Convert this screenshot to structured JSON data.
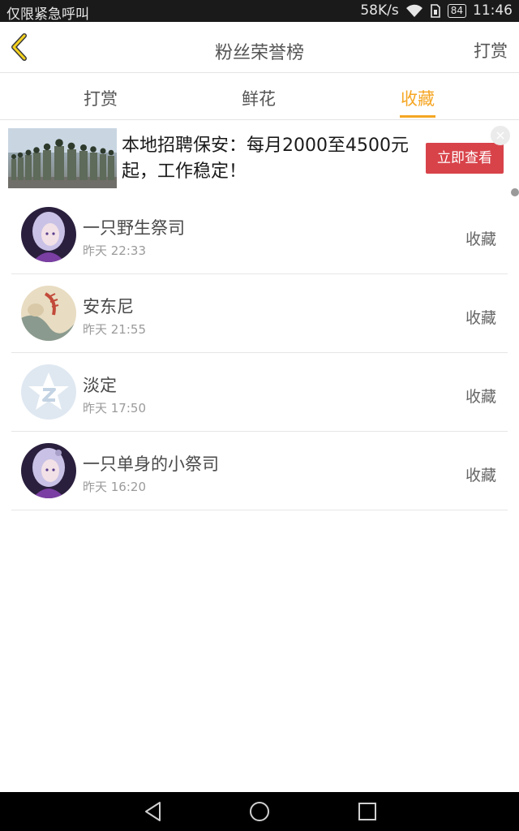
{
  "status_bar": {
    "left_text": "仅限紧急呼叫",
    "speed": "58K/s",
    "battery": "84",
    "time": "11:46"
  },
  "header": {
    "title": "粉丝荣誉榜",
    "right_action": "打赏"
  },
  "tabs": [
    {
      "label": "打赏",
      "active": false
    },
    {
      "label": "鲜花",
      "active": false
    },
    {
      "label": "收藏",
      "active": true
    }
  ],
  "ad": {
    "text": "本地招聘保安：每月2000至4500元起，工作稳定！",
    "button": "立即查看",
    "close": "×"
  },
  "list": [
    {
      "name": "一只野生祭司",
      "time": "昨天 22:33",
      "action": "收藏"
    },
    {
      "name": "安东尼",
      "time": "昨天 21:55",
      "action": "收藏"
    },
    {
      "name": "淡定",
      "time": "昨天 17:50",
      "action": "收藏"
    },
    {
      "name": "一只单身的小祭司",
      "time": "昨天 16:20",
      "action": "收藏"
    }
  ],
  "colors": {
    "accent": "#f5a623",
    "ad_button": "#d8434a"
  }
}
